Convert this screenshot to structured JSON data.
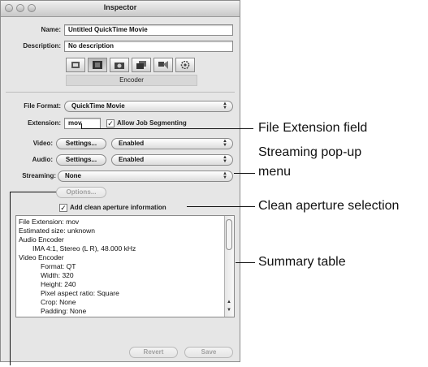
{
  "window": {
    "title": "Inspector"
  },
  "fields": {
    "name_label": "Name:",
    "name_value": "Untitled QuickTime Movie",
    "description_label": "Description:",
    "description_value": "No description"
  },
  "toolbar": {
    "tabs": [
      "general-icon",
      "film-icon",
      "camera-icon",
      "layers-icon",
      "filters-icon",
      "gear-icon"
    ],
    "selected_index": 1,
    "section_label": "Encoder"
  },
  "encoder": {
    "file_format_label": "File Format:",
    "file_format_value": "QuickTime Movie",
    "extension_label": "Extension:",
    "extension_value": "mov",
    "allow_segmenting_label": "Allow Job Segmenting",
    "allow_segmenting_checked": true,
    "video_label": "Video:",
    "video_settings_button": "Settings...",
    "video_state": "Enabled",
    "audio_label": "Audio:",
    "audio_settings_button": "Settings...",
    "audio_state": "Enabled",
    "streaming_label": "Streaming:",
    "streaming_value": "None",
    "options_button": "Options...",
    "clean_aperture_label": "Add clean aperture information",
    "clean_aperture_checked": true
  },
  "summary": {
    "lines": [
      "File Extension: mov",
      "Estimated size: unknown",
      "Audio Encoder",
      "IMA 4:1, Stereo (L R), 48.000 kHz",
      "Video Encoder",
      "Format: QT",
      "Width: 320",
      "Height: 240",
      "Pixel aspect ratio: Square",
      "Crop: None",
      "Padding: None"
    ]
  },
  "footer": {
    "revert_button": "Revert",
    "save_button": "Save"
  },
  "callouts": {
    "file_extension": "File Extension field",
    "streaming_line1": "Streaming pop-up",
    "streaming_line2": "menu",
    "clean_aperture": "Clean aperture selection",
    "summary_table": "Summary table"
  }
}
